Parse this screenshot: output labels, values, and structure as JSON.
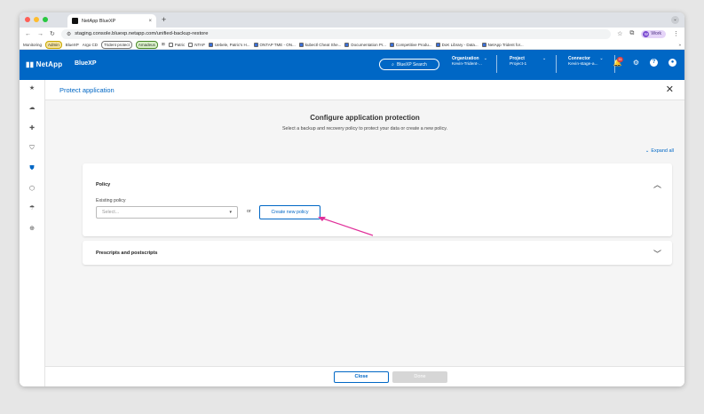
{
  "browser": {
    "tab_title": "NetApp BlueXP",
    "tab_close": "×",
    "new_tab": "+",
    "url": "staging.console.bluexp.netapp.com/unified-backup-restore",
    "profile_initial": "W",
    "profile_label": "Work",
    "bookmarks": [
      {
        "label": "Monitoring",
        "style": "plain"
      },
      {
        "label": "Admin",
        "style": "pill",
        "color": "#f4e29a",
        "border": "#c9a800"
      },
      {
        "label": "BlueXP",
        "style": "plain"
      },
      {
        "label": "Argo CD",
        "style": "plain"
      },
      {
        "label": "Trident protect",
        "style": "pill",
        "color": "#fff",
        "border": "#777"
      },
      {
        "label": "Amadeus",
        "style": "pill",
        "color": "#d8f0c8",
        "border": "#4a8a2a"
      },
      {
        "label": "Patric",
        "style": "folder"
      },
      {
        "label": "NTAP",
        "style": "folder"
      },
      {
        "label": "Uebele, Patric's H...",
        "style": "link"
      },
      {
        "label": "ONTAP TME - ON...",
        "style": "link"
      },
      {
        "label": "kubectl Cheat She...",
        "style": "link"
      },
      {
        "label": "Documentation Pr...",
        "style": "link"
      },
      {
        "label": "Competitive Produ...",
        "style": "link"
      },
      {
        "label": "DoK Library - Data...",
        "style": "link"
      },
      {
        "label": "NetApp Trident for...",
        "style": "link"
      }
    ],
    "bookmarks_more": "»"
  },
  "header": {
    "logo": "NetApp",
    "product": "BlueXP",
    "search_label": "BlueXP Search",
    "organization": {
      "label": "Organization",
      "value": "Kevin-Trident-..."
    },
    "project": {
      "label": "Project",
      "value": "Project-1"
    },
    "connector": {
      "label": "Connector",
      "value": "Kevin-stage-a..."
    },
    "notification_count": "11"
  },
  "page": {
    "title": "Protect application",
    "heading": "Configure application protection",
    "subheading": "Select a backup and recovery policy to protect your data or create a new policy.",
    "expand_all": "Expand all",
    "policy_section": {
      "title": "Policy",
      "field_label": "Existing policy",
      "select_placeholder": "Select...",
      "or_label": "or",
      "create_button": "Create new policy"
    },
    "scripts_section": {
      "title": "Prescripts and postscripts"
    }
  },
  "footer": {
    "close_label": "Close",
    "done_label": "Done"
  },
  "colors": {
    "brand": "#0067c5",
    "annotation_arrow": "#e0309a"
  }
}
